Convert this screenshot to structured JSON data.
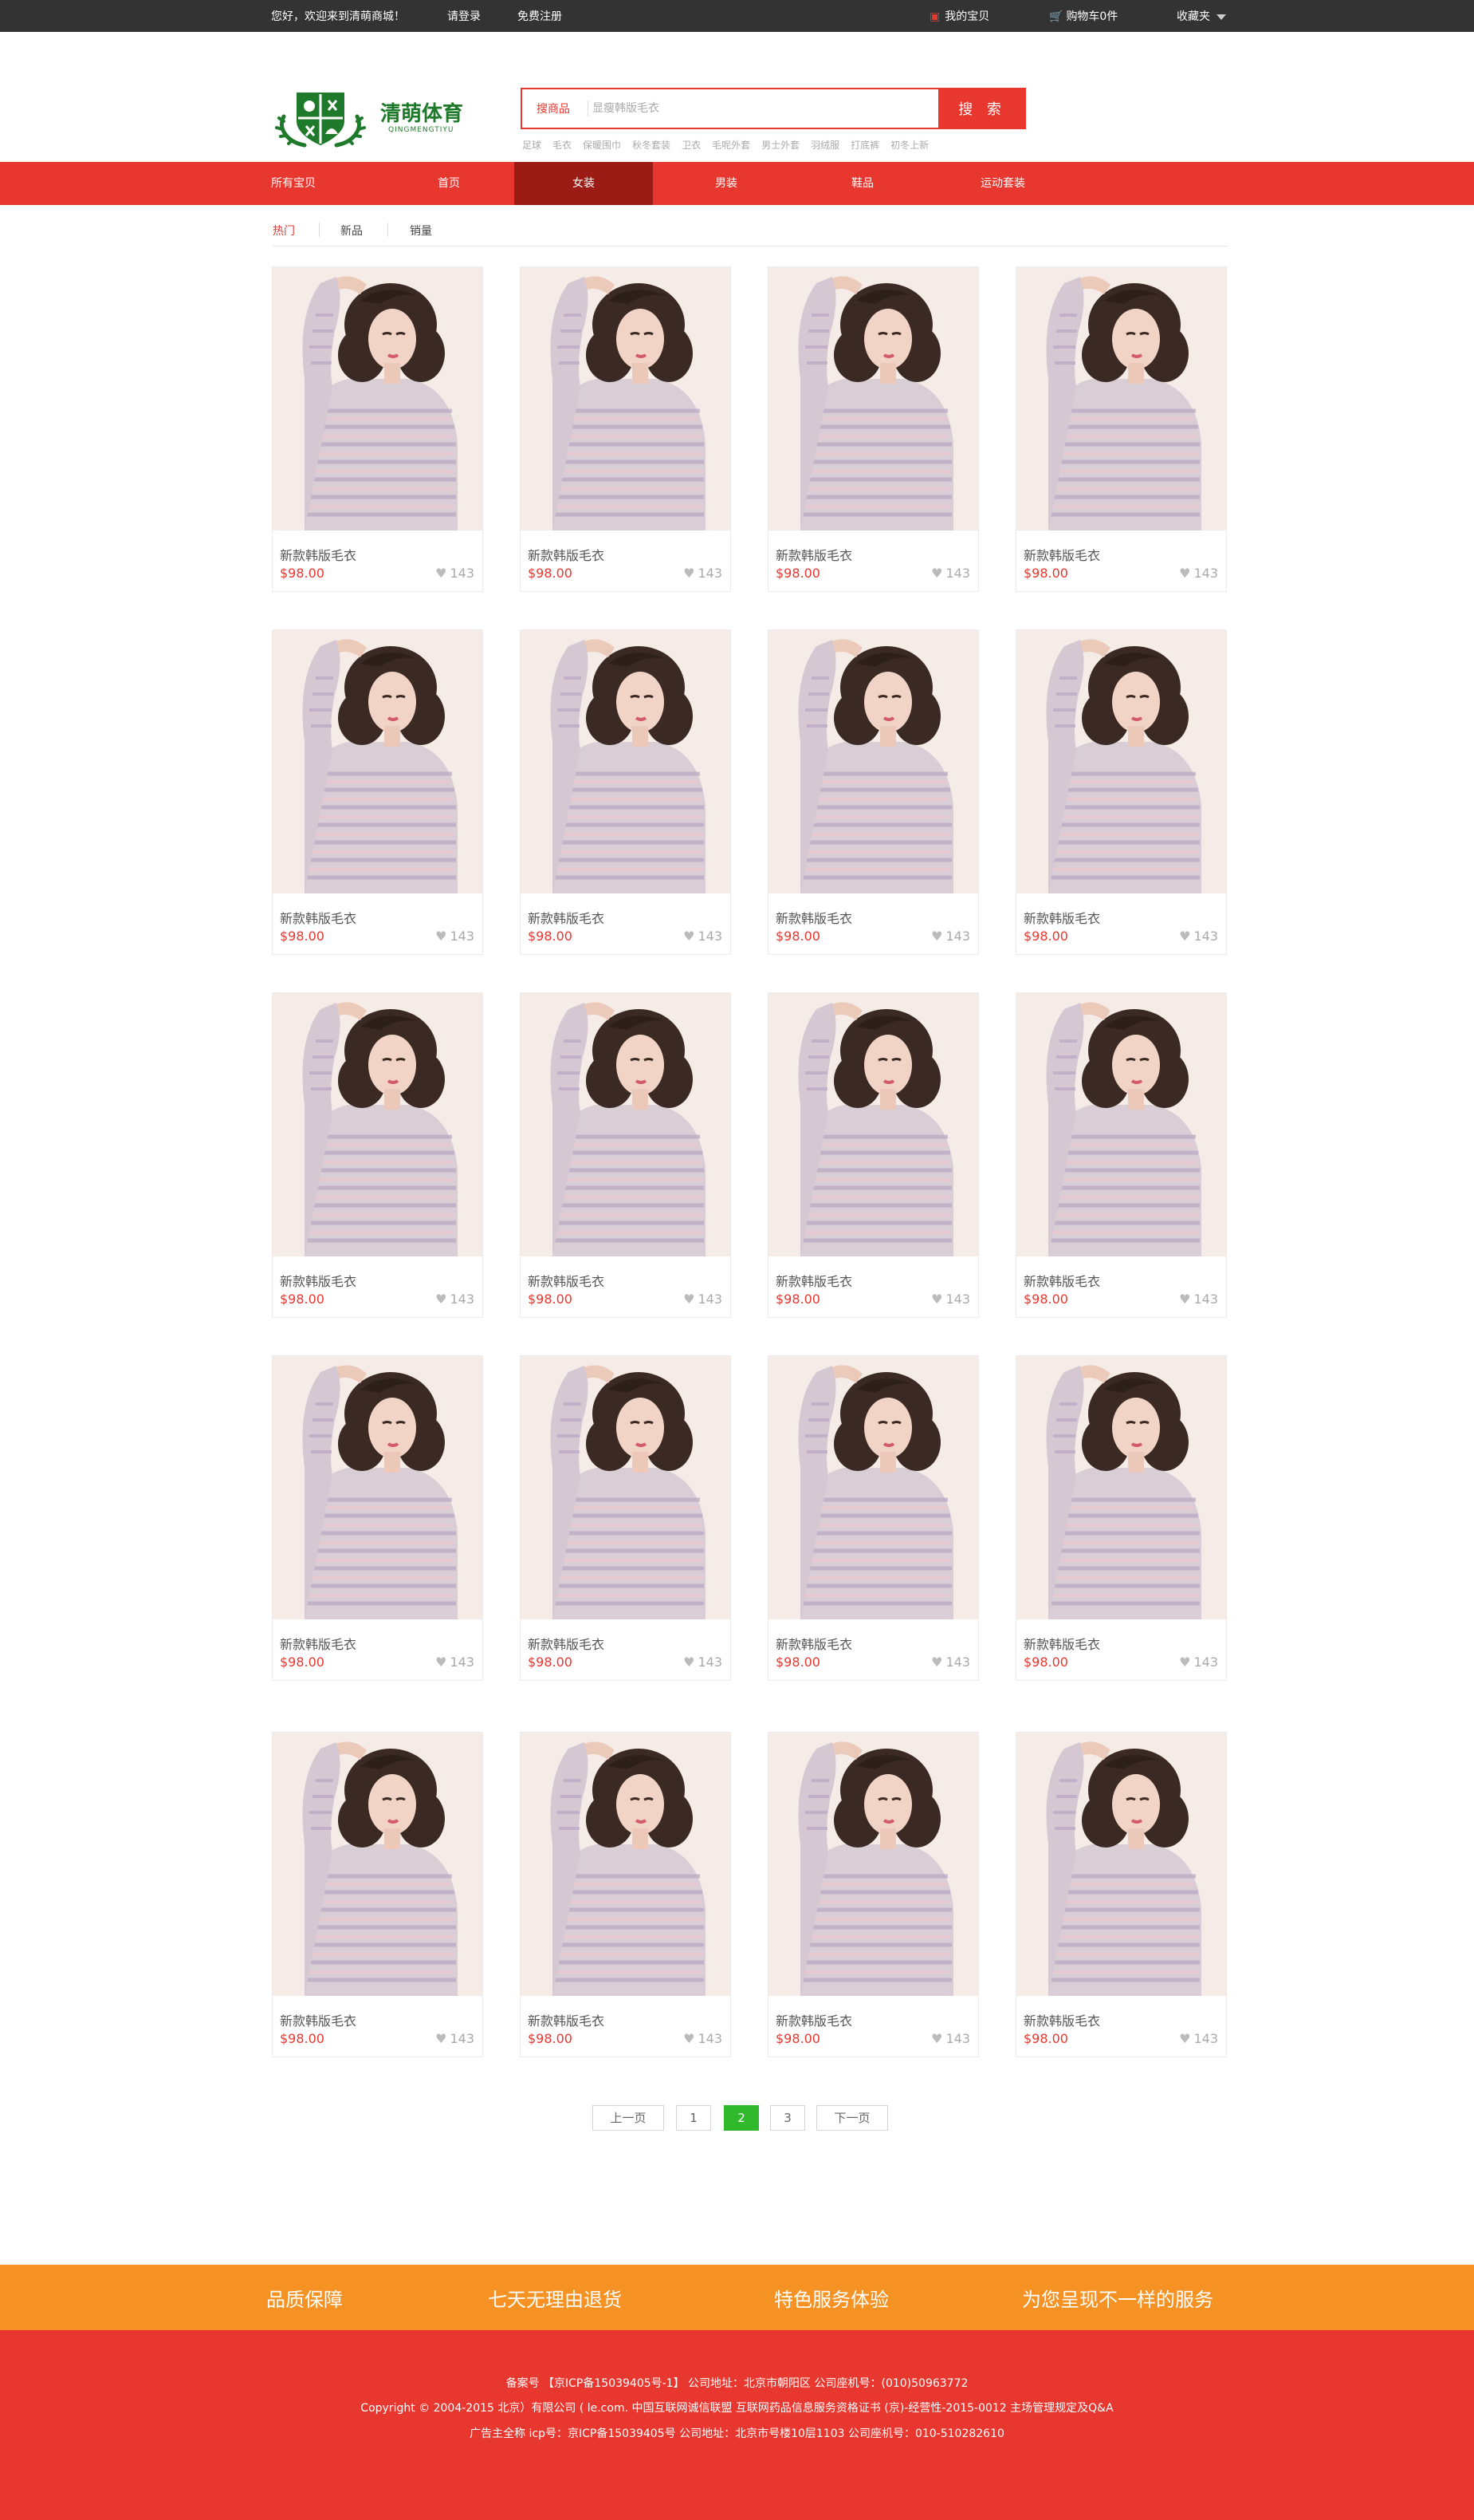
{
  "topbar": {
    "welcome": "您好，欢迎来到清萌商城！",
    "login": "请登录",
    "register": "免费注册",
    "my_items": "我的宝贝",
    "cart": "购物车0件",
    "favorites": "收藏夹"
  },
  "logo": {
    "title": "清萌体育",
    "subtitle": "QINGMENGTIYU"
  },
  "search": {
    "label": "搜商品",
    "placeholder": "显瘦韩版毛衣",
    "button": "搜 索"
  },
  "hotwords": [
    "足球",
    "毛衣",
    "保暖围巾",
    "秋冬套装",
    "卫衣",
    "毛呢外套",
    "男士外套",
    "羽绒服",
    "打底裤",
    "初冬上新"
  ],
  "nav": [
    "所有宝贝",
    "首页",
    "女装",
    "男装",
    "鞋品",
    "运动套装"
  ],
  "nav_active": "女装",
  "sort": [
    "热门",
    "新品",
    "销量"
  ],
  "sort_active": "热门",
  "product": {
    "name": "新款韩版毛衣",
    "price": "$98.00",
    "likes": "143"
  },
  "pager": {
    "prev": "上一页",
    "pages": [
      "1",
      "2",
      "3"
    ],
    "current": "2",
    "next": "下一页"
  },
  "promise": [
    "品质保障",
    "七天无理由退货",
    "特色服务体验",
    "为您呈现不一样的服务"
  ],
  "footer": {
    "line1": "备案号 【京ICP备15039405号-1】   公司地址：北京市朝阳区 公司座机号：(010)50963772",
    "line2": "Copyright © 2004-2015 北京）有限公司 ( le.com.  中国互联网诚信联盟 互联网药品信息服务资格证书 (京)-经营性-2015-0012     主场管理规定及Q&A",
    "line3": "广告主全称    icp号：京ICP备15039405号    公司地址：北京市号楼10层1103    公司座机号：010-510282610"
  },
  "colors": {
    "brand_red": "#e8372f",
    "nav_active": "#9b1b15",
    "logo_green": "#1e7a2a",
    "promise_orange": "#f69223",
    "pager_green": "#30b92c"
  }
}
